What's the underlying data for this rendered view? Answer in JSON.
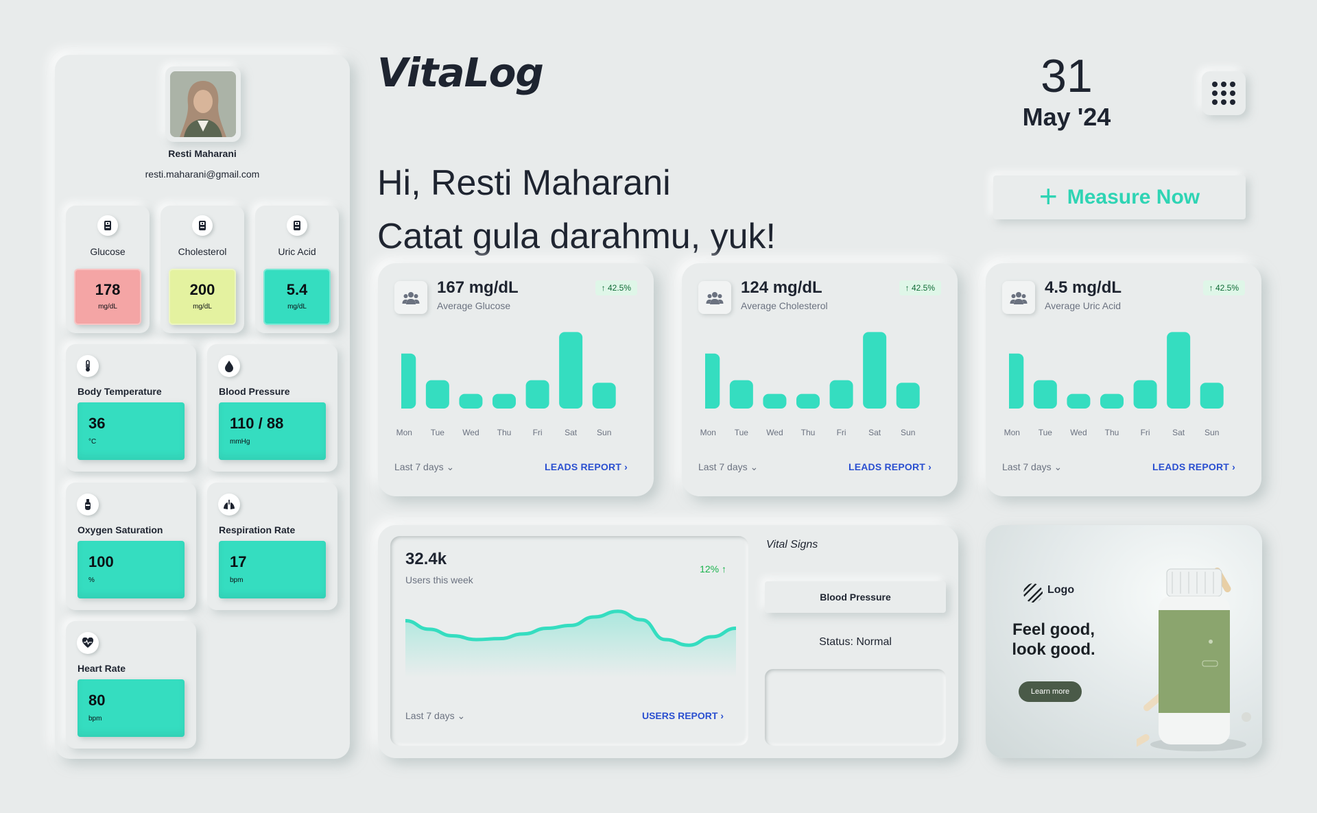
{
  "app": {
    "name": "VitaLog"
  },
  "date": {
    "day": "31",
    "month_year": "May '24"
  },
  "profile": {
    "name": "Resti Maharani",
    "email": "resti.maharani@gmail.com"
  },
  "lab_results": [
    {
      "label": "Glucose",
      "value": "178",
      "unit": "mg/dL",
      "color": "#f4a5a5",
      "icon": "blood-test-icon"
    },
    {
      "label": "Cholesterol",
      "value": "200",
      "unit": "mg/dL",
      "color": "#e4f2a0",
      "icon": "blood-test-icon"
    },
    {
      "label": "Uric Acid",
      "value": "5.4",
      "unit": "mg/dL",
      "color": "#35ddc0",
      "icon": "blood-test-icon"
    }
  ],
  "vitals": [
    {
      "label": "Body Temperature",
      "value": "36",
      "unit": "°C",
      "icon": "thermometer-icon"
    },
    {
      "label": "Blood Pressure",
      "value": "110 / 88",
      "unit": "mmHg",
      "icon": "blood-drop-icon"
    },
    {
      "label": "Oxygen Saturation",
      "value": "100",
      "unit": "%",
      "icon": "oxygen-tank-icon"
    },
    {
      "label": "Respiration Rate",
      "value": "17",
      "unit": "bpm",
      "icon": "lungs-icon"
    },
    {
      "label": "Heart Rate",
      "value": "80",
      "unit": "bpm",
      "icon": "heart-rate-icon"
    }
  ],
  "greeting": {
    "line1": "Hi, Resti Maharani",
    "line2": "Catat gula darahmu, yuk!"
  },
  "measure_button": {
    "label": "Measure Now"
  },
  "stat_cards": [
    {
      "value": "167 mg/dL",
      "label": "Average Glucose",
      "badge": "42.5%",
      "footer_left": "Last 7 days",
      "footer_right": "LEADS REPORT"
    },
    {
      "value": "124 mg/dL",
      "label": "Average Cholesterol",
      "badge": "42.5%",
      "footer_left": "Last 7 days",
      "footer_right": "LEADS REPORT"
    },
    {
      "value": "4.5 mg/dL",
      "label": "Average Uric Acid",
      "badge": "42.5%",
      "footer_left": "Last 7 days",
      "footer_right": "LEADS REPORT"
    }
  ],
  "chart_data": [
    {
      "type": "bar",
      "categories": [
        "Mon",
        "Tue",
        "Wed",
        "Thu",
        "Fri",
        "Sat",
        "Sun"
      ],
      "values": [
        64,
        33,
        17,
        17,
        33,
        89,
        30
      ],
      "color": "#35ddc0"
    },
    {
      "type": "bar",
      "categories": [
        "Mon",
        "Tue",
        "Wed",
        "Thu",
        "Fri",
        "Sat",
        "Sun"
      ],
      "values": [
        64,
        33,
        17,
        17,
        33,
        89,
        30
      ],
      "color": "#35ddc0"
    },
    {
      "type": "bar",
      "categories": [
        "Mon",
        "Tue",
        "Wed",
        "Thu",
        "Fri",
        "Sat",
        "Sun"
      ],
      "values": [
        64,
        33,
        17,
        17,
        33,
        89,
        30
      ],
      "color": "#35ddc0"
    },
    {
      "type": "area",
      "values": [
        60,
        51,
        44,
        40,
        41,
        46,
        52,
        55,
        64,
        70,
        61,
        40,
        34,
        43,
        52
      ],
      "color": "#35ddc0"
    }
  ],
  "users": {
    "value": "32.4k",
    "label": "Users this week",
    "change": "12% ↑",
    "footer_left": "Last 7 days",
    "footer_right": "USERS REPORT"
  },
  "vital_signs": {
    "title": "Vital Signs",
    "selected": "Blood Pressure",
    "status": "Status: Normal"
  },
  "ad": {
    "logo": "Logo",
    "headline": "Feel good, look good.",
    "cta": "Learn more"
  },
  "colors": {
    "accent": "#35ddc0",
    "link": "#2a4fd0",
    "background": "#e8ebeb"
  }
}
